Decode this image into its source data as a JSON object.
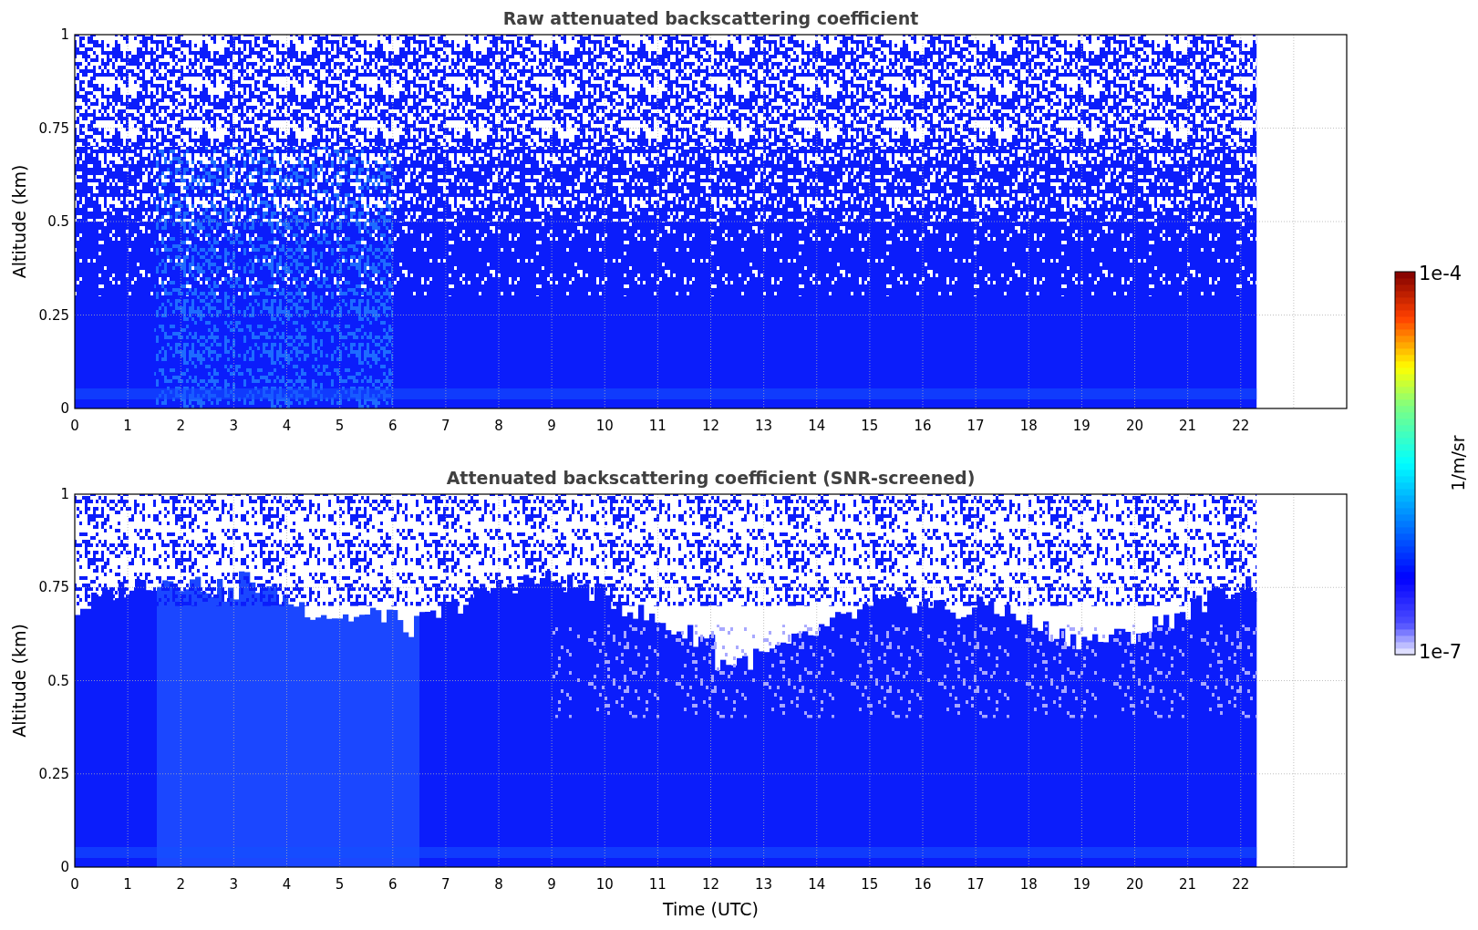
{
  "panels": [
    {
      "kind": "raw",
      "title": "Raw attenuated backscattering coefficient",
      "ylabel": "Altitude (km)",
      "yticks": [
        "1",
        "0.75",
        "0.5",
        "0.25",
        "0"
      ],
      "xticks": [
        "0",
        "1",
        "2",
        "3",
        "4",
        "5",
        "6",
        "7",
        "8",
        "9",
        "10",
        "11",
        "12",
        "13",
        "14",
        "15",
        "16",
        "17",
        "18",
        "19",
        "20",
        "21",
        "22"
      ]
    },
    {
      "kind": "screened",
      "title": "Attenuated backscattering coefficient (SNR-screened)",
      "ylabel": "Altitude (km)",
      "yticks": [
        "1",
        "0.75",
        "0.5",
        "0.25",
        "0"
      ],
      "xticks": [
        "0",
        "1",
        "2",
        "3",
        "4",
        "5",
        "6",
        "7",
        "8",
        "9",
        "10",
        "11",
        "12",
        "13",
        "14",
        "15",
        "16",
        "17",
        "18",
        "19",
        "20",
        "21",
        "22"
      ]
    }
  ],
  "xlabel": "Time (UTC)",
  "colorbar": {
    "label": "1/m/sr",
    "max_label": "1e-4",
    "min_label": "1e-7"
  }
}
